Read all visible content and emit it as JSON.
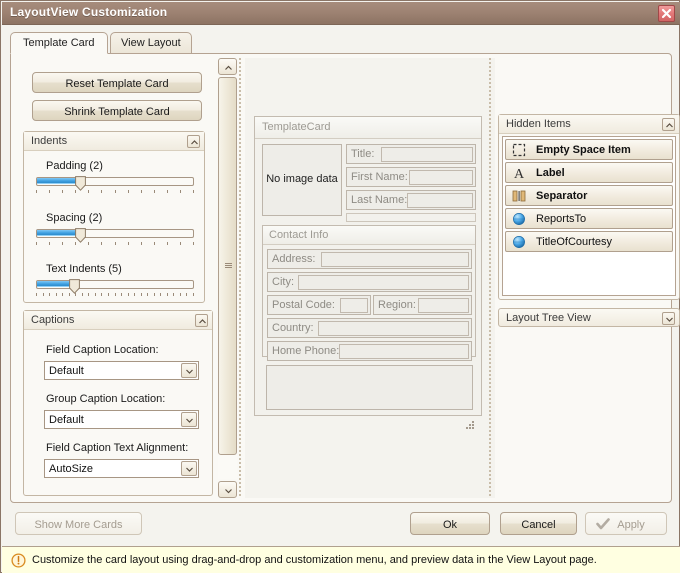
{
  "window": {
    "title": "LayoutView Customization",
    "close_label": "close-icon"
  },
  "tabs": [
    {
      "label": "Template Card",
      "active": true
    },
    {
      "label": "View Layout",
      "active": false
    }
  ],
  "left_panel": {
    "reset_button": "Reset Template Card",
    "shrink_button": "Shrink Template Card",
    "indents": {
      "title": "Indents",
      "sliders": [
        {
          "label": "Padding (2)",
          "value": 2,
          "fill_percent": 28,
          "thumb_percent": 28,
          "ticks": 13
        },
        {
          "label": "Spacing (2)",
          "value": 2,
          "fill_percent": 28,
          "thumb_percent": 28,
          "ticks": 13
        },
        {
          "label": "Text Indents (5)",
          "value": 5,
          "fill_percent": 24,
          "thumb_percent": 24,
          "ticks": 25
        }
      ]
    },
    "captions": {
      "title": "Captions",
      "fields": [
        {
          "label": "Field Caption Location:",
          "value": "Default"
        },
        {
          "label": "Group Caption Location:",
          "value": "Default"
        },
        {
          "label": "Field Caption Text Alignment:",
          "value": "AutoSize"
        }
      ]
    }
  },
  "card": {
    "title": "TemplateCard",
    "photo_text": "No image data",
    "fields": [
      {
        "caption": "Title:"
      },
      {
        "caption": "First Name:"
      },
      {
        "caption": "Last Name:"
      }
    ],
    "contact_group": {
      "title": "Contact Info",
      "fields": [
        {
          "caption": "Address:"
        },
        {
          "caption": "City:"
        },
        {
          "caption": "Postal Code:"
        },
        {
          "caption": "Region:"
        },
        {
          "caption": "Country:"
        },
        {
          "caption": "Home Phone:"
        }
      ]
    }
  },
  "right_panel": {
    "hidden_items": {
      "title": "Hidden Items",
      "items": [
        {
          "label": "Empty Space Item",
          "icon": "dashed-square-icon",
          "bold": true
        },
        {
          "label": "Label",
          "icon": "letter-a-icon",
          "bold": true
        },
        {
          "label": "Separator",
          "icon": "separator-bars-icon",
          "bold": true
        },
        {
          "label": "ReportsTo",
          "icon": "blue-sphere-icon",
          "bold": false
        },
        {
          "label": "TitleOfCourtesy",
          "icon": "blue-sphere-icon",
          "bold": false
        }
      ]
    },
    "tree_view": {
      "title": "Layout Tree View"
    }
  },
  "footer": {
    "show_more": "Show More Cards",
    "ok": "Ok",
    "cancel": "Cancel",
    "apply": "Apply"
  },
  "status": {
    "icon": "info-exclamation-icon",
    "text": "Customize the card layout using drag-and-drop and customization menu, and preview data in the View Layout page."
  },
  "colors": {
    "titlebar": "#9e8373",
    "accent_blue": "#3d9fe0",
    "close_red": "#e27878",
    "status_bg": "#ffffe1"
  }
}
